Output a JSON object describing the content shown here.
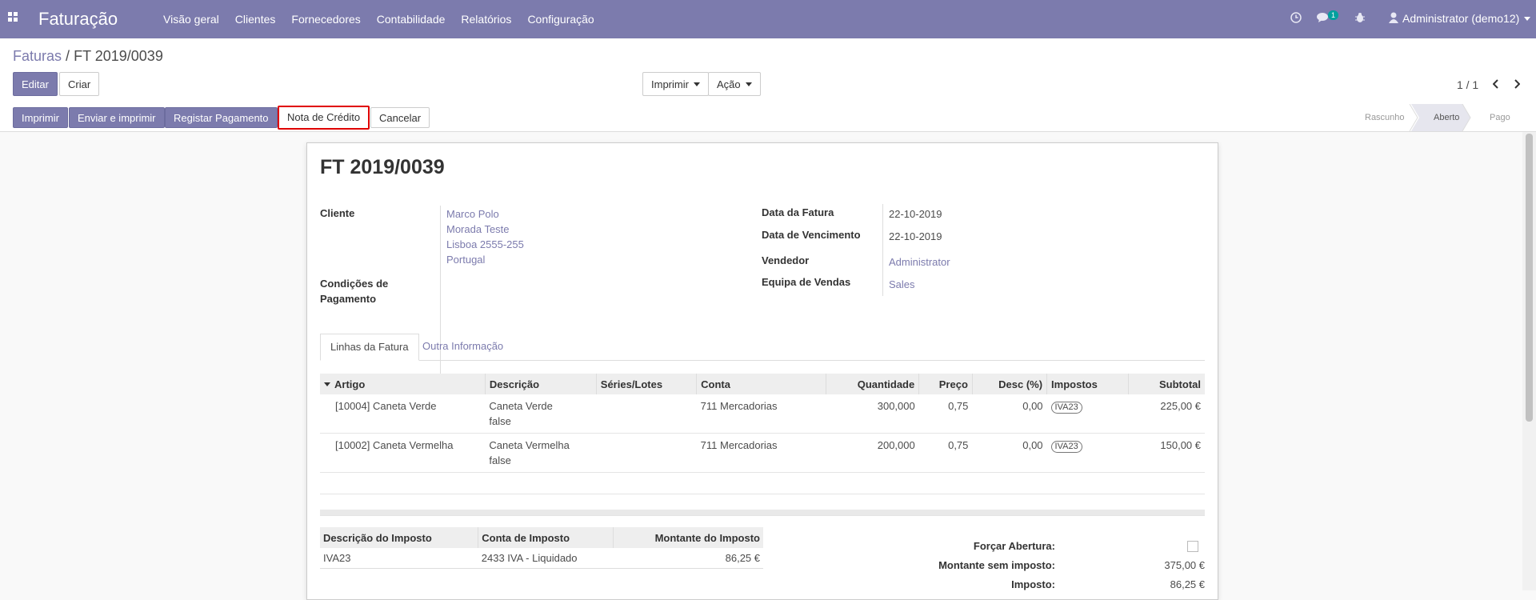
{
  "navbar": {
    "brand": "Faturação",
    "menu": [
      "Visão geral",
      "Clientes",
      "Fornecedores",
      "Contabilidade",
      "Relatórios",
      "Configuração"
    ],
    "messages_badge": "1",
    "user": "Administrator (demo12)"
  },
  "control_panel": {
    "breadcrumb_parent": "Faturas",
    "breadcrumb_separator": "/",
    "breadcrumb_current": "FT 2019/0039",
    "edit_label": "Editar",
    "create_label": "Criar",
    "print_menu_label": "Imprimir",
    "action_menu_label": "Ação",
    "pager": "1 / 1"
  },
  "header_buttons": {
    "print": "Imprimir",
    "send_print": "Enviar e imprimir",
    "register_payment": "Registar Pagamento",
    "credit_note": "Nota de Crédito",
    "cancel": "Cancelar"
  },
  "statusbar": {
    "stages": [
      "Rascunho",
      "Aberto",
      "Pago"
    ],
    "active": "Aberto"
  },
  "invoice": {
    "number": "FT 2019/0039",
    "customer_label": "Cliente",
    "customer_lines": [
      "Marco Polo",
      "Morada Teste",
      "Lisboa 2555-255",
      "Portugal"
    ],
    "payment_terms_label": "Condições de Pagamento",
    "payment_terms_line1": "Condições de",
    "payment_terms_line2": "Pagamento",
    "invoice_date_label": "Data da Fatura",
    "invoice_date": "22-10-2019",
    "due_date_label": "Data de Vencimento",
    "due_date": "22-10-2019",
    "salesperson_label": "Vendedor",
    "salesperson": "Administrator",
    "sales_team_label": "Equipa de Vendas",
    "sales_team": "Sales"
  },
  "tabs": [
    "Linhas da Fatura",
    "Outra Informação"
  ],
  "lines": {
    "columns": [
      "Artigo",
      "Descrição",
      "Séries/Lotes",
      "Conta",
      "Quantidade",
      "Preço",
      "Desc (%)",
      "Impostos",
      "Subtotal"
    ],
    "rows": [
      {
        "product": "[10004] Caneta Verde",
        "desc1": "Caneta Verde",
        "desc2": "false",
        "lots": "",
        "account": "711 Mercadorias",
        "qty": "300,000",
        "price": "0,75",
        "disc": "0,00",
        "tax": "IVA23",
        "subtotal": "225,00 €"
      },
      {
        "product": "[10002] Caneta Vermelha",
        "desc1": "Caneta Vermelha",
        "desc2": "false",
        "lots": "",
        "account": "711 Mercadorias",
        "qty": "200,000",
        "price": "0,75",
        "disc": "0,00",
        "tax": "IVA23",
        "subtotal": "150,00 €"
      }
    ]
  },
  "taxes": {
    "columns": [
      "Descrição do Imposto",
      "Conta de Imposto",
      "Montante do Imposto"
    ],
    "rows": [
      {
        "desc": "IVA23",
        "account": "2433 IVA - Liquidado",
        "amount": "86,25 €"
      }
    ]
  },
  "totals": {
    "force_open_label": "Forçar Abertura:",
    "untaxed_label": "Montante sem imposto:",
    "untaxed": "375,00 €",
    "tax_label": "Imposto:",
    "tax": "86,25 €"
  },
  "colors": {
    "brand": "#7c7bad",
    "highlight": "#e00000"
  }
}
